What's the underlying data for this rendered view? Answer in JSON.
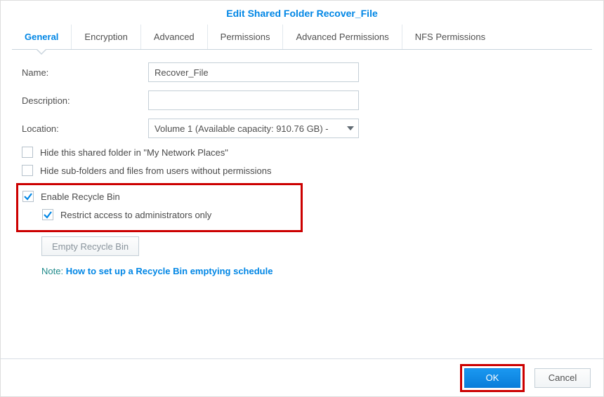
{
  "dialog": {
    "title": "Edit Shared Folder Recover_File"
  },
  "tabs": {
    "general": "General",
    "encryption": "Encryption",
    "advanced": "Advanced",
    "permissions": "Permissions",
    "advanced_permissions": "Advanced Permissions",
    "nfs_permissions": "NFS Permissions"
  },
  "form": {
    "name_label": "Name:",
    "name_value": "Recover_File",
    "description_label": "Description:",
    "description_value": "",
    "location_label": "Location:",
    "location_value": "Volume 1 (Available capacity: 910.76 GB) -"
  },
  "checkboxes": {
    "hide_network": "Hide this shared folder in \"My Network Places\"",
    "hide_subfolders": "Hide sub-folders and files from users without permissions",
    "enable_recycle": "Enable Recycle Bin",
    "restrict_admin": "Restrict access to administrators only"
  },
  "buttons": {
    "empty_recycle": "Empty Recycle Bin",
    "ok": "OK",
    "cancel": "Cancel"
  },
  "note": {
    "label": "Note:",
    "link": "How to set up a Recycle Bin emptying schedule"
  }
}
